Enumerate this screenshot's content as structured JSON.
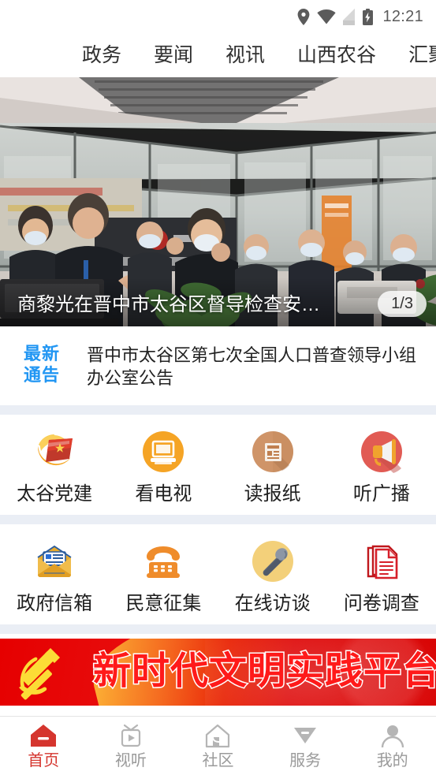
{
  "statusbar": {
    "time": "12:21",
    "icons": [
      "location-pin-icon",
      "wifi-icon",
      "sim-card-icon",
      "battery-charging-icon"
    ]
  },
  "topnav": {
    "items": [
      {
        "label": "政务"
      },
      {
        "label": "要闻"
      },
      {
        "label": "视讯"
      },
      {
        "label": "山西农谷"
      },
      {
        "label": "汇聚"
      }
    ]
  },
  "hero": {
    "caption": "商黎光在晋中市太谷区督导检查安…",
    "counter": "1/3"
  },
  "notice": {
    "badge_line1": "最新",
    "badge_line2": "通告",
    "badge_color": "#2196f3",
    "title": "晋中市太谷区第七次全国人口普查领导小组办公室公告"
  },
  "grid": {
    "row1": [
      {
        "label": "太谷党建",
        "icon": "party-building-icon"
      },
      {
        "label": "看电视",
        "icon": "television-icon"
      },
      {
        "label": "读报纸",
        "icon": "newspaper-icon"
      },
      {
        "label": "听广播",
        "icon": "radio-megaphone-icon"
      }
    ],
    "row2": [
      {
        "label": "政府信箱",
        "icon": "mailbox-envelope-icon"
      },
      {
        "label": "民意征集",
        "icon": "telephone-icon"
      },
      {
        "label": "在线访谈",
        "icon": "microphone-icon"
      },
      {
        "label": "问卷调查",
        "icon": "questionnaire-icon"
      }
    ]
  },
  "redbanner": {
    "text": "新时代文明实践平台",
    "emblem": "hammer-sickle-icon",
    "bg_color": "#e60000",
    "text_color": "#ff1a1a"
  },
  "bottomnav": {
    "active_color": "#d5352e",
    "inactive_color": "#9a9a9a",
    "items": [
      {
        "label": "首页",
        "icon": "home-icon",
        "active": true
      },
      {
        "label": "视听",
        "icon": "tv-play-icon",
        "active": false
      },
      {
        "label": "社区",
        "icon": "community-house-icon",
        "active": false
      },
      {
        "label": "服务",
        "icon": "service-shield-icon",
        "active": false
      },
      {
        "label": "我的",
        "icon": "profile-person-icon",
        "active": false
      }
    ]
  }
}
